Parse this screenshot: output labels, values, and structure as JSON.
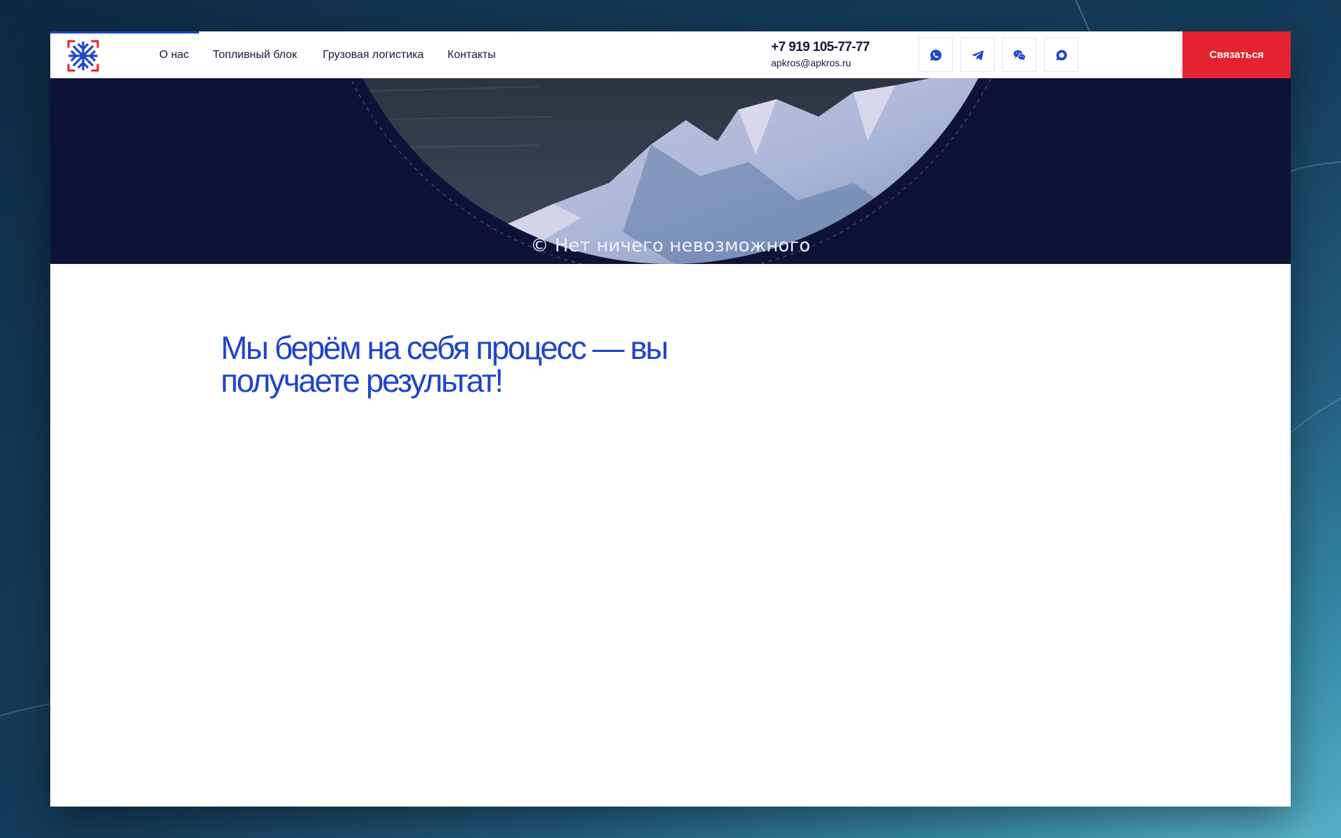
{
  "header": {
    "nav": [
      "О нас",
      "Топливный блок",
      "Грузовая логистика",
      "Контакты"
    ],
    "phone": "+7 919 105-77-77",
    "email": "apkros@apkros.ru",
    "socials": [
      "whatsapp-icon",
      "telegram-icon",
      "wechat-icon",
      "chat-icon"
    ],
    "cta_label": "Связаться",
    "accent_color": "#1f45c8",
    "cta_color": "#e52330"
  },
  "hero": {
    "quote": "© Нет ничего невозможного",
    "background_color": "#0f1238"
  },
  "main": {
    "headline": "Мы берём на себя процесс — вы получаете результат!"
  }
}
